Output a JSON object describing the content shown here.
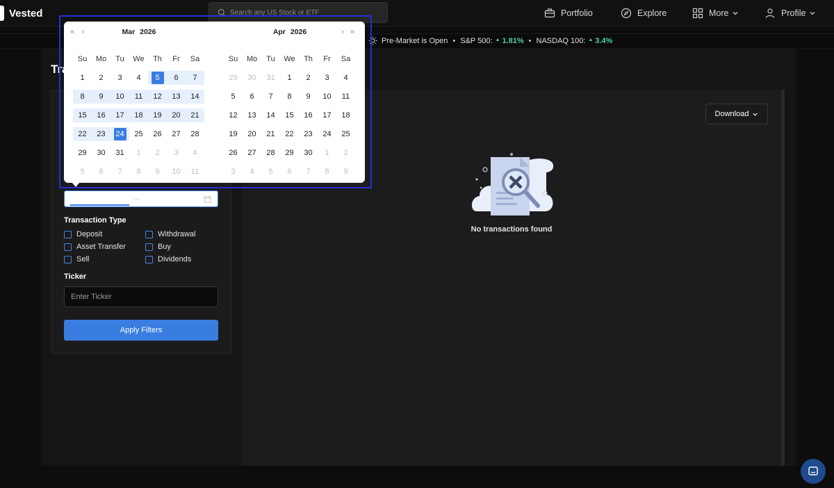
{
  "header": {
    "brand": "Vested",
    "search_placeholder": "Search any US Stock or ETF",
    "nav": [
      {
        "label": "Portfolio",
        "icon": "briefcase-icon"
      },
      {
        "label": "Explore",
        "icon": "compass-icon"
      },
      {
        "label": "More",
        "icon": "grid-icon"
      },
      {
        "label": "Profile",
        "icon": "user-icon"
      }
    ]
  },
  "ticker_bar": {
    "market_status": "Pre-Market is Open",
    "sp500_label": "S&P 500:",
    "sp500_value": "1.81%",
    "nasdaq_label": "NASDAQ 100:",
    "nasdaq_value": "3.4%"
  },
  "page": {
    "title_partial": "Tra"
  },
  "calendar": {
    "left": {
      "month": "Mar",
      "year": "2026",
      "weekdays": [
        "Su",
        "Mo",
        "Tu",
        "We",
        "Th",
        "Fr",
        "Sa"
      ],
      "weeks": [
        [
          "1",
          "2",
          "3",
          "4",
          "5",
          "6",
          "7"
        ],
        [
          "8",
          "9",
          "10",
          "11",
          "12",
          "13",
          "14"
        ],
        [
          "15",
          "16",
          "17",
          "18",
          "19",
          "20",
          "21"
        ],
        [
          "22",
          "23",
          "24",
          "25",
          "26",
          "27",
          "28"
        ],
        [
          "29",
          "30",
          "31",
          "1",
          "2",
          "3",
          "4"
        ],
        [
          "5",
          "6",
          "7",
          "8",
          "9",
          "10",
          "11"
        ]
      ]
    },
    "right": {
      "month": "Apr",
      "year": "2026",
      "weekdays": [
        "Su",
        "Mo",
        "Tu",
        "We",
        "Th",
        "Fr",
        "Sa"
      ],
      "weeks": [
        [
          "29",
          "30",
          "31",
          "1",
          "2",
          "3",
          "4"
        ],
        [
          "5",
          "6",
          "7",
          "8",
          "9",
          "10",
          "11"
        ],
        [
          "12",
          "13",
          "14",
          "15",
          "16",
          "17",
          "18"
        ],
        [
          "19",
          "20",
          "21",
          "22",
          "23",
          "24",
          "25"
        ],
        [
          "26",
          "27",
          "28",
          "29",
          "30",
          "1",
          "2"
        ],
        [
          "3",
          "4",
          "5",
          "6",
          "7",
          "8",
          "9"
        ]
      ]
    },
    "nav_icons": [
      "double-chevron-left-icon",
      "chevron-left-icon",
      "chevron-right-icon",
      "double-chevron-right-icon"
    ]
  },
  "filters": {
    "date_arrow": "→",
    "transaction_type_label": "Transaction Type",
    "types": [
      "Deposit",
      "Withdrawal",
      "Asset Transfer",
      "Buy",
      "Sell",
      "Dividends"
    ],
    "ticker_label": "Ticker",
    "ticker_placeholder": "Enter Ticker",
    "apply_label": "Apply Filters"
  },
  "results": {
    "download_label": "Download",
    "empty_message": "No transactions found"
  },
  "colors": {
    "accent": "#3a7de0",
    "positive": "#4fd39a",
    "background": "#0d0d0d"
  }
}
